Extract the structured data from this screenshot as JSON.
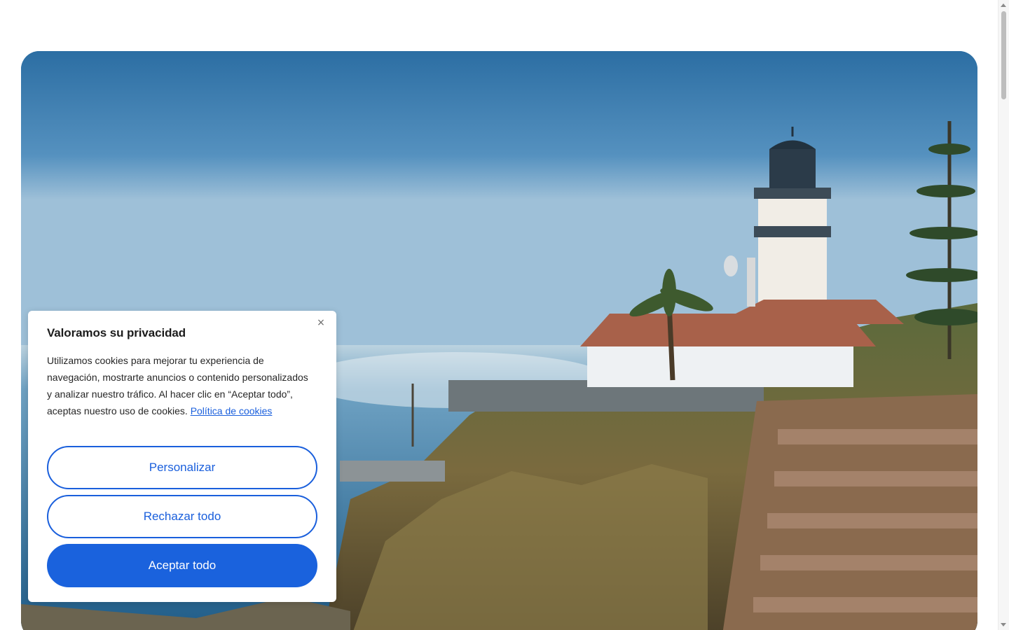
{
  "hero": {
    "image_alt_name": "lighthouse-coast-photo"
  },
  "cookie_banner": {
    "title": "Valoramos su privacidad",
    "close_symbol": "×",
    "body_text": "Utilizamos cookies para mejorar tu experiencia de navegación, mostrarte anuncios o contenido personalizados y analizar nuestro tráfico. Al hacer clic en “Aceptar todo”, aceptas nuestro uso de cookies.",
    "policy_link": "Política de cookies",
    "buttons": {
      "personalize": "Personalizar",
      "reject_all": "Rechazar todo",
      "accept_all": "Aceptar todo"
    }
  },
  "colors": {
    "accent": "#1a62dd",
    "link": "#1a5fdc",
    "dialog_bg": "#ffffff"
  }
}
